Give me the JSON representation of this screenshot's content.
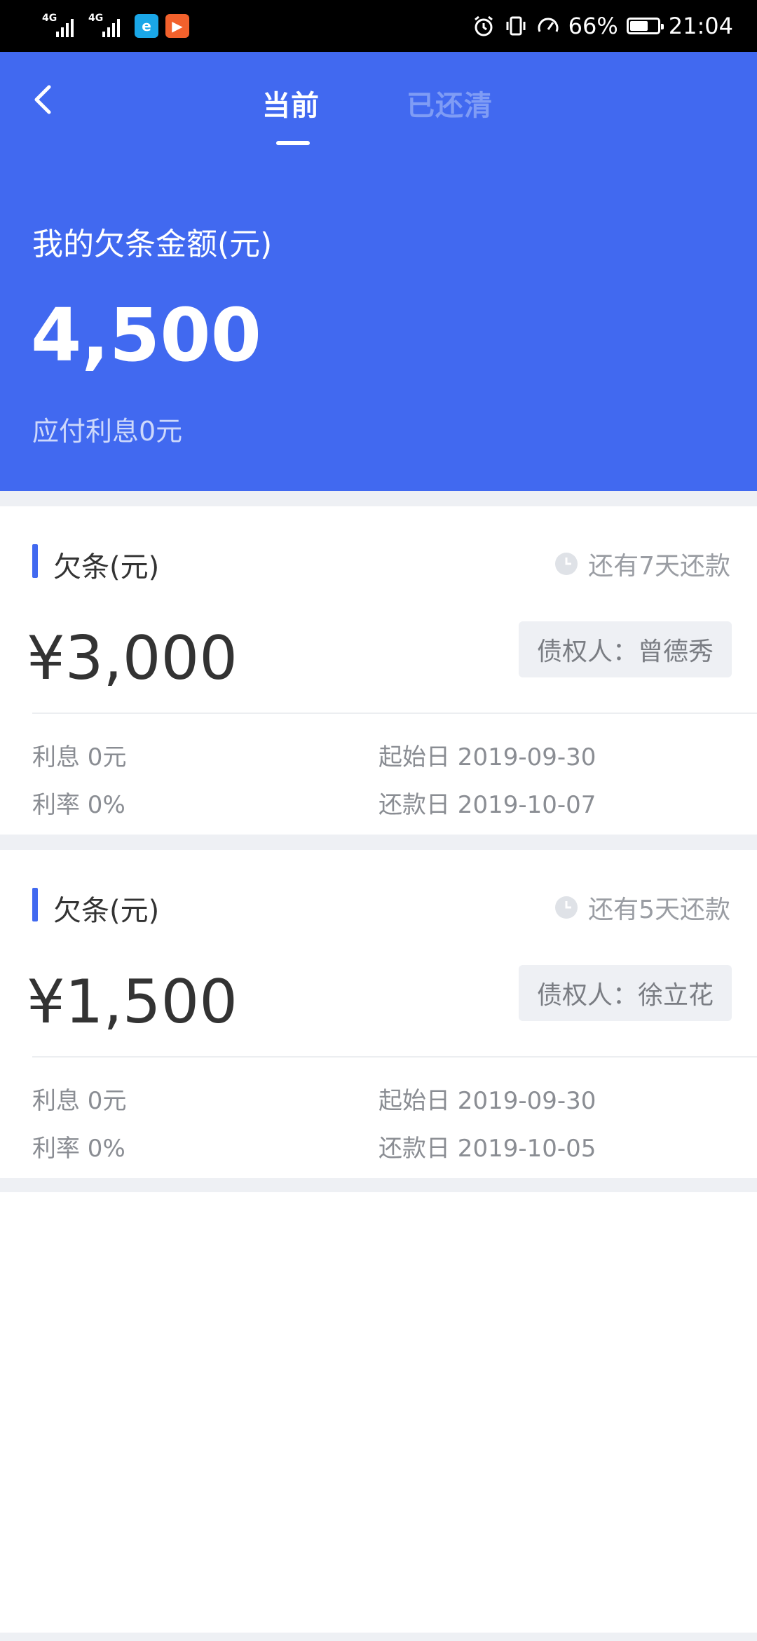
{
  "status_bar": {
    "network1": "4G",
    "network2": "4G",
    "battery": "66%",
    "battery_level": 0.66,
    "time": "21:04"
  },
  "header": {
    "tabs": [
      {
        "label": "当前",
        "active": true
      },
      {
        "label": "已还清",
        "active": false
      }
    ],
    "label": "我的欠条金额(元)",
    "total_amount": "4,500",
    "interest_text": "应付利息0元"
  },
  "loans": [
    {
      "title": "欠条(元)",
      "due_text": "还有7天还款",
      "amount": "¥3,000",
      "creditor": "债权人：曾德秀",
      "interest": "利息 0元",
      "rate": "利率 0%",
      "start_date": "起始日 2019-09-30",
      "repay_date": "还款日 2019-10-07"
    },
    {
      "title": "欠条(元)",
      "due_text": "还有5天还款",
      "amount": "¥1,500",
      "creditor": "债权人：徐立花",
      "interest": "利息 0元",
      "rate": "利率 0%",
      "start_date": "起始日 2019-09-30",
      "repay_date": "还款日 2019-10-05"
    }
  ],
  "colors": {
    "primary": "#4169f0",
    "inactive_tab": "#7f9cf5",
    "background_gap": "#eef0f4",
    "text_dark": "#333333",
    "text_muted": "#8a8d93"
  }
}
